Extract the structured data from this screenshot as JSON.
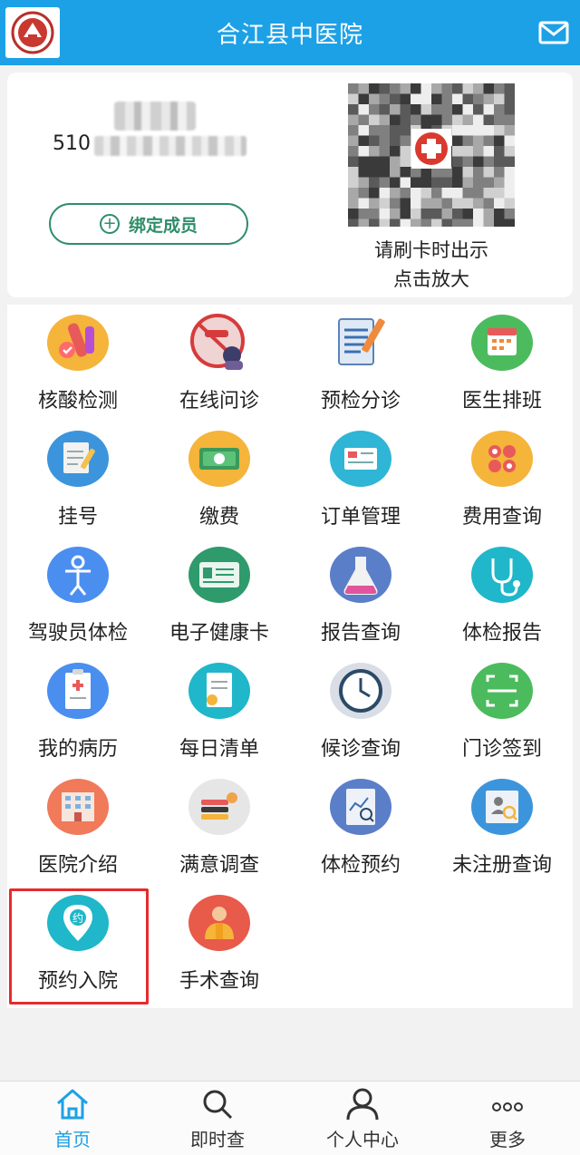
{
  "header": {
    "title": "合江县中医院",
    "logo_icon": "hospital-logo-icon",
    "mail_icon": "mail-icon"
  },
  "card": {
    "id_prefix": "510",
    "bind_button_label": "绑定成员",
    "qr_caption_line1": "请刷卡时出示",
    "qr_caption_line2": "点击放大"
  },
  "grid": {
    "items": [
      {
        "label": "核酸检测",
        "icon": "nucleic-test-icon"
      },
      {
        "label": "在线问诊",
        "icon": "online-consult-icon"
      },
      {
        "label": "预检分诊",
        "icon": "pre-triage-icon"
      },
      {
        "label": "医生排班",
        "icon": "calendar-icon"
      },
      {
        "label": "挂号",
        "icon": "register-icon"
      },
      {
        "label": "缴费",
        "icon": "payment-icon"
      },
      {
        "label": "订单管理",
        "icon": "order-icon"
      },
      {
        "label": "费用查询",
        "icon": "fee-query-icon"
      },
      {
        "label": "驾驶员体检",
        "icon": "driver-exam-icon"
      },
      {
        "label": "电子健康卡",
        "icon": "health-card-icon"
      },
      {
        "label": "报告查询",
        "icon": "flask-icon"
      },
      {
        "label": "体检报告",
        "icon": "stethoscope-icon"
      },
      {
        "label": "我的病历",
        "icon": "medical-record-icon"
      },
      {
        "label": "每日清单",
        "icon": "daily-list-icon"
      },
      {
        "label": "候诊查询",
        "icon": "clock-icon"
      },
      {
        "label": "门诊签到",
        "icon": "scan-icon"
      },
      {
        "label": "医院介绍",
        "icon": "hospital-building-icon"
      },
      {
        "label": "满意调查",
        "icon": "survey-icon"
      },
      {
        "label": "体检预约",
        "icon": "exam-booking-icon"
      },
      {
        "label": "未注册查询",
        "icon": "unregistered-query-icon"
      },
      {
        "label": "预约入院",
        "icon": "appointment-location-icon"
      },
      {
        "label": "手术查询",
        "icon": "surgery-icon"
      }
    ],
    "highlight_color": "#e62b2b"
  },
  "tabbar": {
    "tabs": [
      {
        "label": "首页",
        "icon": "home-icon",
        "active": true
      },
      {
        "label": "即时查",
        "icon": "search-icon",
        "active": false
      },
      {
        "label": "个人中心",
        "icon": "person-icon",
        "active": false
      },
      {
        "label": "更多",
        "icon": "more-icon",
        "active": false
      }
    ],
    "active_color": "#1da1e6"
  },
  "colors": {
    "brand": "#1da1e6",
    "accent_green": "#2f8d6a"
  }
}
